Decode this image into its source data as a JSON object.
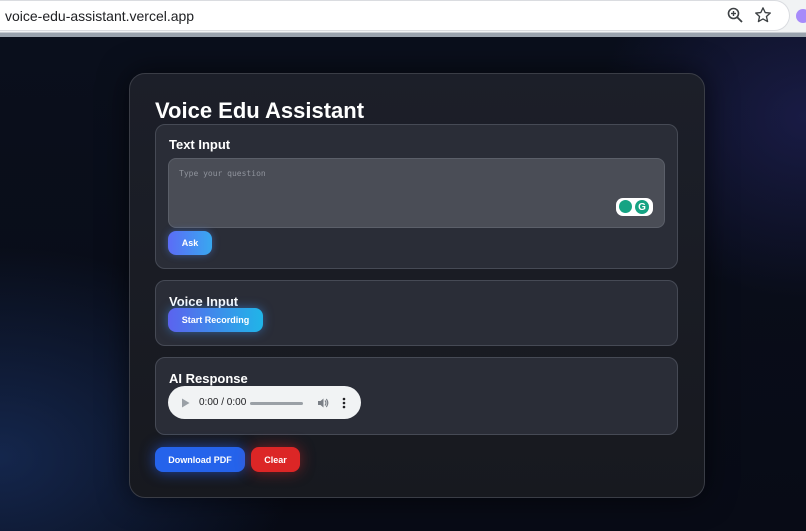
{
  "browser": {
    "url": "voice-edu-assistant.vercel.app",
    "icons": [
      "zoom-icon",
      "star-icon",
      "extension-icon"
    ]
  },
  "app": {
    "title": "Voice Edu Assistant"
  },
  "text_input": {
    "title": "Text Input",
    "placeholder": "Type your question",
    "ask_label": "Ask"
  },
  "voice_input": {
    "title": "Voice Input",
    "record_label": "Start Recording"
  },
  "ai_response": {
    "title": "AI Response",
    "audio_time": "0:00 / 0:00"
  },
  "actions": {
    "download_label": "Download PDF",
    "clear_label": "Clear"
  },
  "colors": {
    "background": "#0b0f1a",
    "card": "#1c1f29",
    "section": "#2a2d37",
    "download": "#2563eb",
    "clear": "#dc2626",
    "grammarly": "#15a383"
  }
}
